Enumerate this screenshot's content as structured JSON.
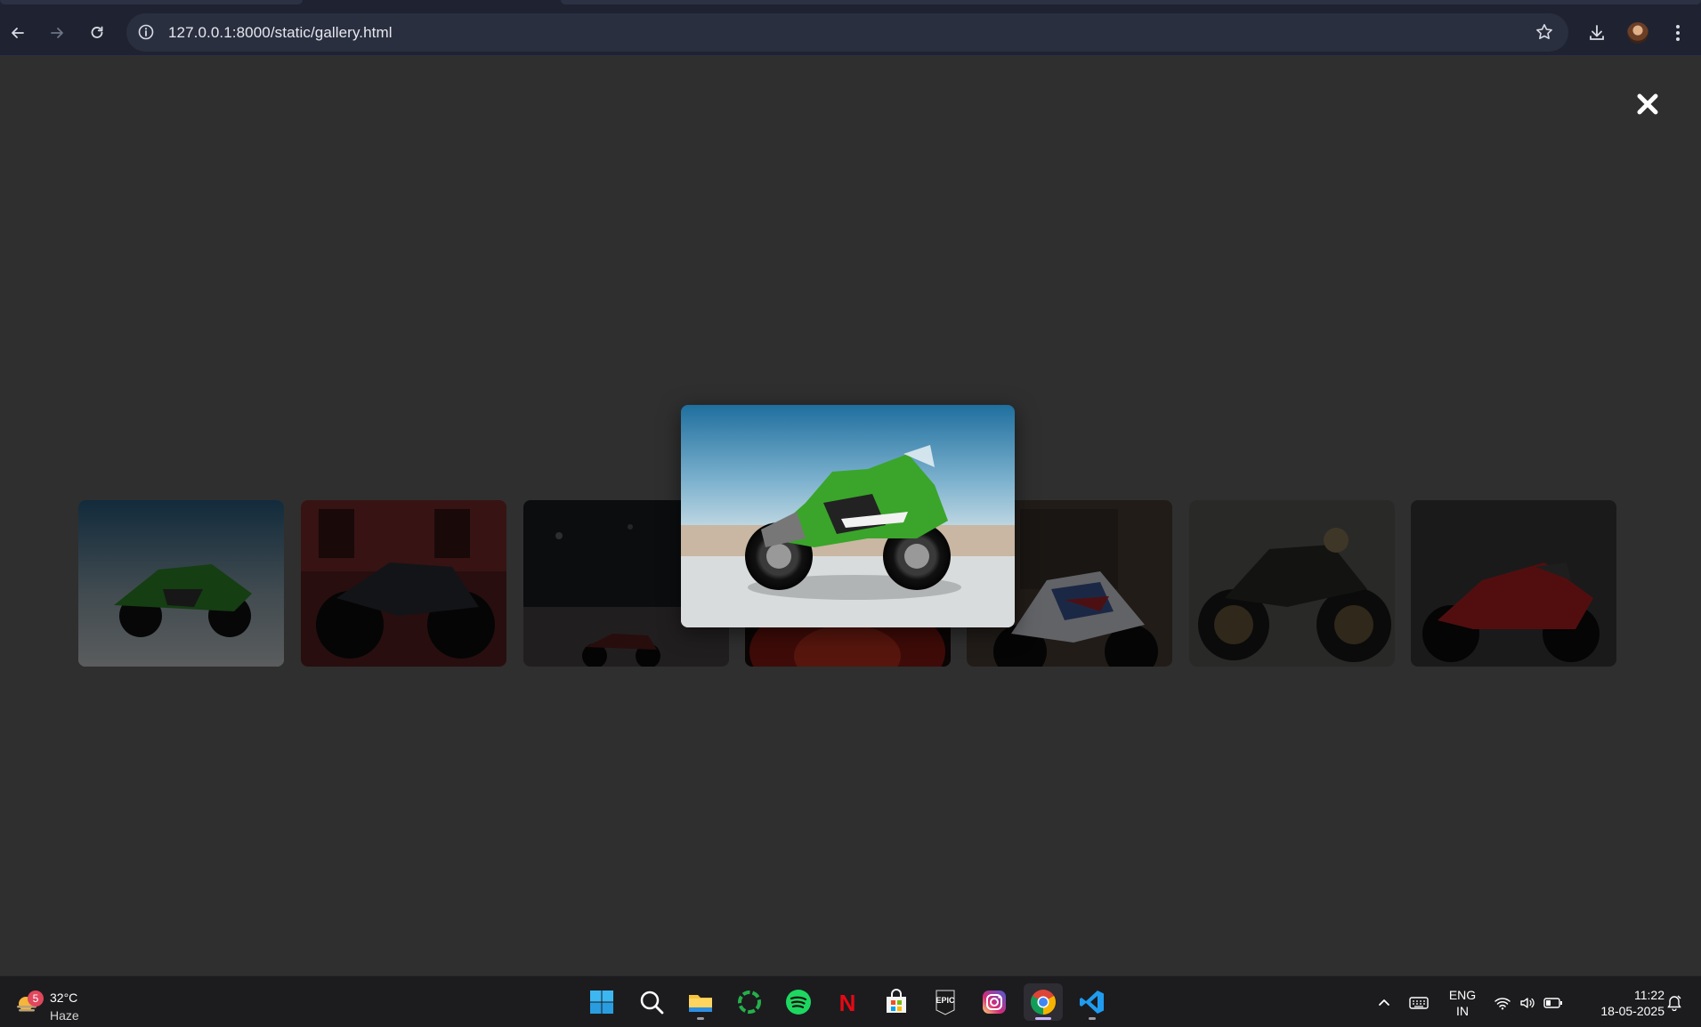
{
  "browser": {
    "url": "127.0.0.1:8000/static/gallery.html",
    "icons": {
      "back": "arrow-left-icon",
      "forward": "arrow-right-icon",
      "reload": "reload-icon",
      "site_info": "info-icon",
      "bookmark": "star-icon",
      "downloads": "download-icon",
      "menu": "kebab-menu-icon"
    }
  },
  "gallery": {
    "close_icon": "close-icon",
    "focused_image": {
      "subject": "green sport motorcycle",
      "accent": "#3aa52a"
    },
    "thumbnails": [
      {
        "subject": "green sport bike",
        "accent": "#2f8a2a"
      },
      {
        "subject": "black naked bike",
        "accent": "#3a3d46"
      },
      {
        "subject": "motorcycle on night road",
        "accent": "#5a1d1d"
      },
      {
        "subject": "red motorcycle",
        "accent": "#8a1a12"
      },
      {
        "subject": "white blue superbike",
        "accent": "#3c5a9a"
      },
      {
        "subject": "scrambler motorcycle",
        "accent": "#4a4a48"
      },
      {
        "subject": "red superbike",
        "accent": "#8e1c1c"
      }
    ]
  },
  "taskbar": {
    "weather": {
      "temp": "32°C",
      "condition": "Haze",
      "badge": "5"
    },
    "apps": [
      {
        "name": "start-icon",
        "active": false
      },
      {
        "name": "search-icon",
        "active": false
      },
      {
        "name": "file-explorer-icon",
        "active": false
      },
      {
        "name": "refresh-app-icon",
        "active": false
      },
      {
        "name": "spotify-icon",
        "active": false
      },
      {
        "name": "netflix-icon",
        "active": false
      },
      {
        "name": "store-icon",
        "active": false
      },
      {
        "name": "epic-games-icon",
        "active": false
      },
      {
        "name": "instagram-icon",
        "active": false
      },
      {
        "name": "chrome-icon",
        "active": true
      },
      {
        "name": "vscode-icon",
        "active": false
      }
    ],
    "epic_label": "EPIC",
    "netflix_label": "N",
    "lang_line1": "ENG",
    "lang_line2": "IN",
    "time": "11:22",
    "date": "18-05-2025"
  }
}
